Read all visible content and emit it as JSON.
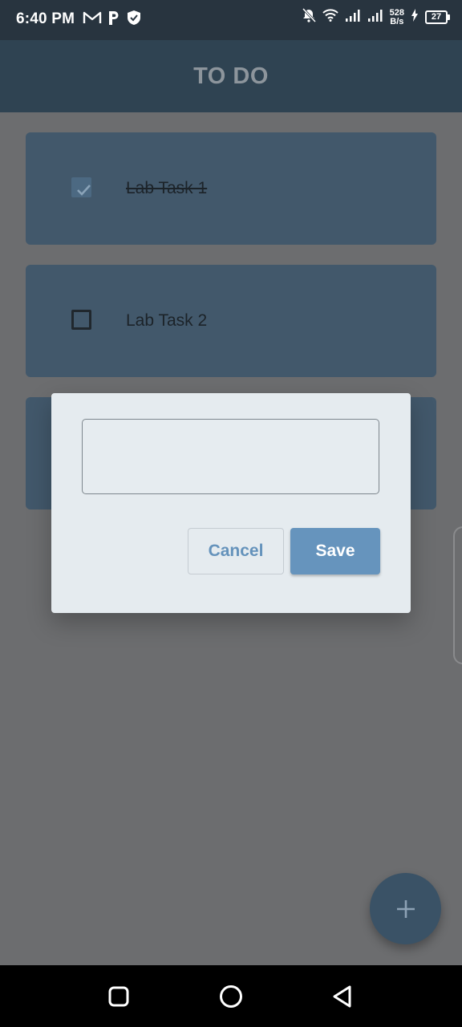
{
  "status_bar": {
    "time": "6:40 PM",
    "net_speed_value": "528",
    "net_speed_unit": "B/s",
    "battery_level": "27",
    "icons": [
      "gmail-icon",
      "p-app-icon",
      "shield-check-icon",
      "bell-off-icon",
      "wifi-icon",
      "signal-icon",
      "signal-icon",
      "charging-icon",
      "battery-icon"
    ]
  },
  "app_bar": {
    "title": "TO DO"
  },
  "tasks": [
    {
      "label": "Lab Task 1",
      "checked": true
    },
    {
      "label": "Lab Task 2",
      "checked": false
    }
  ],
  "dialog": {
    "input_value": "",
    "input_placeholder": "",
    "cancel_label": "Cancel",
    "save_label": "Save"
  },
  "fab": {
    "icon": "plus-icon"
  },
  "nav_bar": {
    "icons": [
      "recents-icon",
      "home-icon",
      "back-icon"
    ]
  },
  "colors": {
    "app_bar": "#2f4352",
    "card": "#42586b",
    "dialog": "#e5ebef",
    "accent": "#6694bd"
  }
}
